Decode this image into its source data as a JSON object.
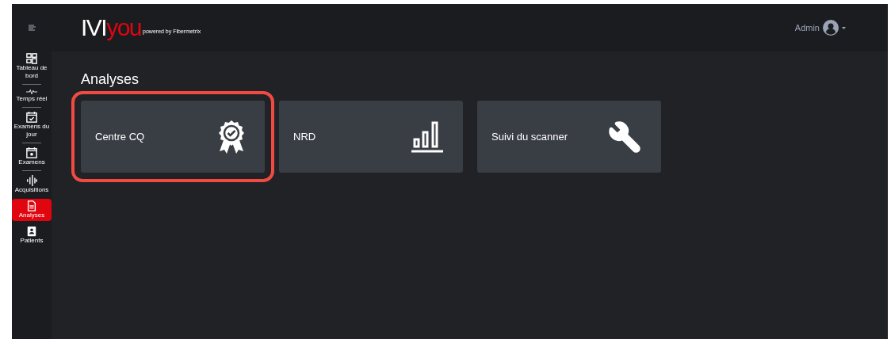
{
  "header": {
    "logo_left": "IVI",
    "logo_right": "you",
    "tagline": "powered by Fibermetrix",
    "user": "Admin"
  },
  "sidebar": {
    "items": [
      {
        "label": "Tableau de bord",
        "kind": "dashboard",
        "selected": false
      },
      {
        "label": "Temps réel",
        "kind": "pulse",
        "selected": false
      },
      {
        "label": "Examens du jour",
        "kind": "checked",
        "selected": false
      },
      {
        "label": "Examens",
        "kind": "calendar",
        "selected": false
      },
      {
        "label": "Acquisitions",
        "kind": "wave",
        "selected": false
      },
      {
        "label": "Analyses",
        "kind": "document",
        "selected": true
      },
      {
        "label": "Patients",
        "kind": "person",
        "selected": false
      }
    ]
  },
  "page": {
    "title": "Analyses"
  },
  "cards": [
    {
      "label": "Centre CQ",
      "kind": "award",
      "highlighted": true
    },
    {
      "label": "NRD",
      "kind": "chart",
      "highlighted": false
    },
    {
      "label": "Suivi du scanner",
      "kind": "tool",
      "highlighted": false
    }
  ]
}
